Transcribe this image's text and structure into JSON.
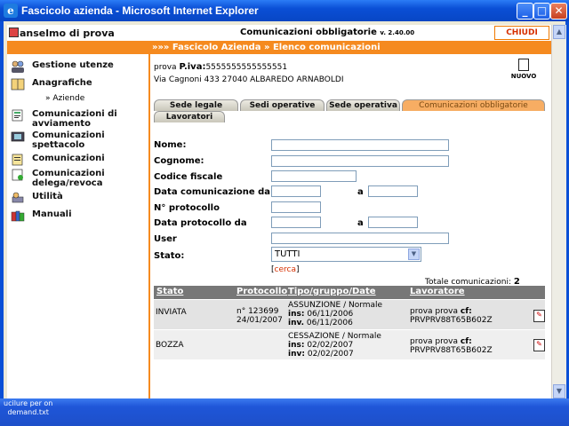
{
  "window": {
    "title": "Fascicolo azienda - Microsoft Internet Explorer",
    "app_icon": "ie-icon",
    "min": "_",
    "max": "□",
    "close": "✕"
  },
  "header": {
    "user": "anselmo di prova",
    "title": "Comunicazioni obbligatorie",
    "version": "v. 2.40.00",
    "close_label": "CHIUDI"
  },
  "breadcrumb": "»»» Fascicolo Azienda » Elenco comunicazioni",
  "sidebar": {
    "items": [
      {
        "label": "Gestione utenze",
        "icon": "users-icon"
      },
      {
        "label": "Anagrafiche",
        "icon": "book-icon"
      },
      {
        "label": "Comunicazioni di avviamento",
        "icon": "document-icon"
      },
      {
        "label": "Comunicazioni spettacolo",
        "icon": "film-icon"
      },
      {
        "label": "Comunicazioni",
        "icon": "document-icon"
      },
      {
        "label": "Comunicazioni delega/revoca",
        "icon": "delegate-icon"
      },
      {
        "label": "Utilità",
        "icon": "tools-icon"
      },
      {
        "label": "Manuali",
        "icon": "books-icon"
      }
    ],
    "subitem": "» Aziende"
  },
  "company": {
    "name": "prova",
    "piva_label": "P.iva:",
    "piva": "5555555555555551",
    "address": "Via Cagnoni 433 27040 ALBAREDO ARNABOLDI"
  },
  "nuovo_label": "NUOVO",
  "tabs": [
    {
      "label": "Sede legale"
    },
    {
      "label": "Sedi operative"
    },
    {
      "label": "Sede operativa"
    },
    {
      "label": "Comunicazioni obbligatorie"
    },
    {
      "label": "Lavoratori"
    }
  ],
  "form": {
    "nome_label": "Nome:",
    "cognome_label": "Cognome:",
    "cf_label": "Codice fiscale",
    "data_com_label": "Data comunicazione da",
    "a_label": "a",
    "protocollo_label": "N° protocollo",
    "data_prot_label": "Data protocollo da",
    "user_label": "User",
    "stato_label": "Stato:",
    "stato_value": "TUTTI",
    "cerca_open": "[",
    "cerca_label": "cerca",
    "cerca_close": "]"
  },
  "totale": {
    "label": "Totale comunicazioni:",
    "value": "2"
  },
  "table": {
    "headers": [
      "Stato",
      "Protocollo",
      "Tipo/gruppo/Date",
      "Lavoratore"
    ],
    "rows": [
      {
        "stato": "INVIATA",
        "protocollo": "n° 123699",
        "prot_date": "24/01/2007",
        "tipo": "ASSUNZIONE / Normale",
        "ins_label": "ins:",
        "ins": "06/11/2006",
        "inv_label": "inv.",
        "inv": "06/11/2006",
        "lavoratore": "prova prova",
        "cf_label": "cf:",
        "cf": "PRVPRV88T65B602Z"
      },
      {
        "stato": "BOZZA",
        "protocollo": "",
        "prot_date": "",
        "tipo": "CESSAZIONE / Normale",
        "ins_label": "ins:",
        "ins": "02/02/2007",
        "inv_label": "inv:",
        "inv": "02/02/2007",
        "lavoratore": "prova prova",
        "cf_label": "cf:",
        "cf": "PRVPRV88T65B602Z"
      }
    ]
  },
  "taskbar": {
    "line1": "ucilure per on",
    "line2": "demand.txt"
  }
}
